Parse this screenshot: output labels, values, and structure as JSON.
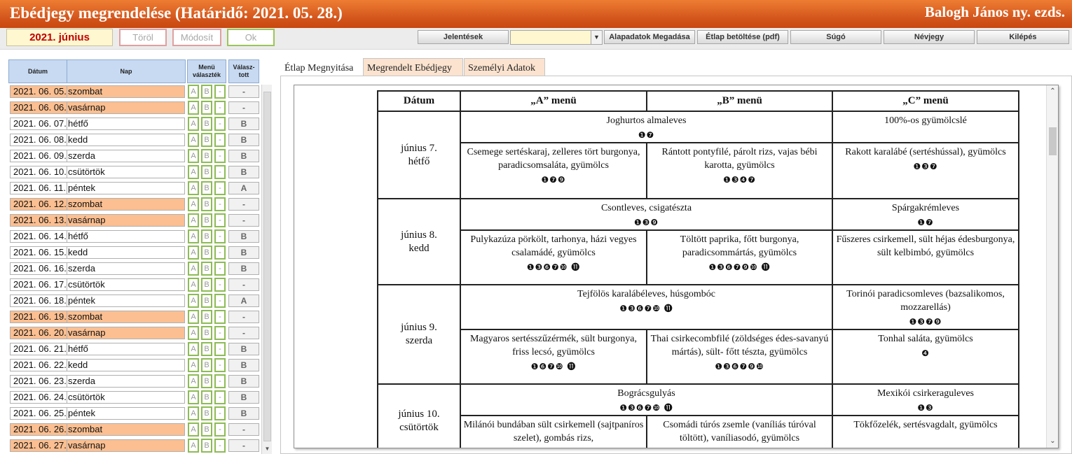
{
  "header": {
    "title": "Ebédjegy megrendelése (Határidő: 2021. 05. 28.)",
    "user": "Balogh János ny. ezds."
  },
  "toolbar": {
    "month": "2021. június",
    "delete": "Töröl",
    "modify": "Módosít",
    "ok": "Ok",
    "reports": "Jelentések",
    "combo_value": "",
    "base_data": "Alapadatok Megadása",
    "load_menu": "Étlap betöltése (pdf)",
    "help": "Súgó",
    "names": "Névjegy",
    "exit": "Kilépés"
  },
  "grid": {
    "headers": {
      "date": "Dátum",
      "day": "Nap",
      "menu": "Menü választék",
      "selected": "Válasz- tott"
    },
    "rows": [
      {
        "date": "2021. 06. 05.",
        "day": "szombat",
        "a": "A",
        "b": "B",
        "c": "-",
        "sel": "-",
        "weekend": true
      },
      {
        "date": "2021. 06. 06.",
        "day": "vasárnap",
        "a": "A",
        "b": "B",
        "c": "-",
        "sel": "-",
        "weekend": true
      },
      {
        "date": "2021. 06. 07.",
        "day": "hétfő",
        "a": "A",
        "b": "B",
        "c": "-",
        "sel": "B",
        "weekend": false
      },
      {
        "date": "2021. 06. 08.",
        "day": "kedd",
        "a": "A",
        "b": "B",
        "c": "-",
        "sel": "B",
        "weekend": false
      },
      {
        "date": "2021. 06. 09.",
        "day": "szerda",
        "a": "A",
        "b": "B",
        "c": "-",
        "sel": "B",
        "weekend": false
      },
      {
        "date": "2021. 06. 10.",
        "day": "csütörtök",
        "a": "A",
        "b": "B",
        "c": "-",
        "sel": "B",
        "weekend": false
      },
      {
        "date": "2021. 06. 11.",
        "day": "péntek",
        "a": "A",
        "b": "B",
        "c": "-",
        "sel": "A",
        "weekend": false
      },
      {
        "date": "2021. 06. 12.",
        "day": "szombat",
        "a": "A",
        "b": "B",
        "c": "-",
        "sel": "-",
        "weekend": true
      },
      {
        "date": "2021. 06. 13.",
        "day": "vasárnap",
        "a": "A",
        "b": "B",
        "c": "-",
        "sel": "-",
        "weekend": true
      },
      {
        "date": "2021. 06. 14.",
        "day": "hétfő",
        "a": "A",
        "b": "B",
        "c": "-",
        "sel": "B",
        "weekend": false
      },
      {
        "date": "2021. 06. 15.",
        "day": "kedd",
        "a": "A",
        "b": "B",
        "c": "-",
        "sel": "B",
        "weekend": false
      },
      {
        "date": "2021. 06. 16.",
        "day": "szerda",
        "a": "A",
        "b": "B",
        "c": "-",
        "sel": "B",
        "weekend": false
      },
      {
        "date": "2021. 06. 17.",
        "day": "csütörtök",
        "a": "A",
        "b": "B",
        "c": "-",
        "sel": "-",
        "weekend": false
      },
      {
        "date": "2021. 06. 18.",
        "day": "péntek",
        "a": "A",
        "b": "B",
        "c": "-",
        "sel": "A",
        "weekend": false
      },
      {
        "date": "2021. 06. 19.",
        "day": "szombat",
        "a": "A",
        "b": "B",
        "c": "-",
        "sel": "-",
        "weekend": true
      },
      {
        "date": "2021. 06. 20.",
        "day": "vasárnap",
        "a": "A",
        "b": "B",
        "c": "-",
        "sel": "-",
        "weekend": true
      },
      {
        "date": "2021. 06. 21.",
        "day": "hétfő",
        "a": "A",
        "b": "B",
        "c": "-",
        "sel": "B",
        "weekend": false
      },
      {
        "date": "2021. 06. 22.",
        "day": "kedd",
        "a": "A",
        "b": "B",
        "c": "-",
        "sel": "B",
        "weekend": false
      },
      {
        "date": "2021. 06. 23.",
        "day": "szerda",
        "a": "A",
        "b": "B",
        "c": "-",
        "sel": "B",
        "weekend": false
      },
      {
        "date": "2021. 06. 24.",
        "day": "csütörtök",
        "a": "A",
        "b": "B",
        "c": "-",
        "sel": "B",
        "weekend": false
      },
      {
        "date": "2021. 06. 25.",
        "day": "péntek",
        "a": "A",
        "b": "B",
        "c": "-",
        "sel": "B",
        "weekend": false
      },
      {
        "date": "2021. 06. 26.",
        "day": "szombat",
        "a": "A",
        "b": "B",
        "c": "-",
        "sel": "-",
        "weekend": true
      },
      {
        "date": "2021. 06. 27.",
        "day": "vasárnap",
        "a": "A",
        "b": "B",
        "c": "-",
        "sel": "-",
        "weekend": true
      }
    ]
  },
  "tabs": [
    {
      "label": "Étlap Megnyitása",
      "active": true
    },
    {
      "label": "Megrendelt Ebédjegy",
      "active": false
    },
    {
      "label": "Személyi Adatok",
      "active": false
    }
  ],
  "menu": {
    "headers": {
      "date": "Dátum",
      "a": "„A” menü",
      "b": "„B” menü",
      "c": "„C” menü"
    },
    "days": [
      {
        "day": "június 7.",
        "weekday": "hétfő",
        "soup_ab": "Joghurtos almaleves",
        "soup_ab_al": "❶❼",
        "soup_c": "100%-os gyümölcslé",
        "soup_c_al": "",
        "a": "Csemege sertéskaraj, zelleres tört burgonya, paradicsomsaláta, gyümölcs",
        "a_al": "❶❼❾",
        "b": "Rántott pontyfilé, párolt rizs, vajas bébi karotta, gyümölcs",
        "b_al": "❶❸❹❼",
        "c": "Rakott karalábé (sertéshússal), gyümölcs",
        "c_al": "❶❸❼"
      },
      {
        "day": "június 8.",
        "weekday": "kedd",
        "soup_ab": "Csontleves, csigatészta",
        "soup_ab_al": "❶❸❾",
        "soup_c": "Spárgakrémleves",
        "soup_c_al": "❶❼",
        "a": "Pulykazúza pörkölt, tarhonya, házi vegyes csalamádé, gyümölcs",
        "a_al": "❶❸❻❼❿ ⓫",
        "b": "Töltött paprika, főtt burgonya, paradicsommártás, gyümölcs",
        "b_al": "❶❸❻❼❾❿ ⓫",
        "c": "Fűszeres csirkemell, sült héjas édesburgonya, sült kelbimbó, gyümölcs",
        "c_al": ""
      },
      {
        "day": "június 9.",
        "weekday": "szerda",
        "soup_ab": "Tejfölös karalábéleves, húsgombóc",
        "soup_ab_al": "❶❸❻❼❿ ⓫",
        "soup_c": "Torinói paradicsomleves (bazsalikomos, mozzarellás)",
        "soup_c_al": "❶❸❼❾",
        "a": "Magyaros sertésszűzérmék, sült burgonya, friss lecsó, gyümölcs",
        "a_al": "❶❻❼❿ ⓫",
        "b": "Thai csirkecombfilé (zöldséges édes-savanyú mártás), sült- főtt tészta, gyümölcs",
        "b_al": "❶❸❻❼❾❿",
        "c": "Tonhal saláta, gyümölcs",
        "c_al": "❹"
      },
      {
        "day": "június 10.",
        "weekday": "csütörtök",
        "soup_ab": "Bográcsgulyás",
        "soup_ab_al": "❶❸❻❼❿ ⓫",
        "soup_c": "Mexikói csirkeraguleves",
        "soup_c_al": "❶❸",
        "a": "Milánói bundában sült csirkemell (sajtpaníros szelet), gombás rizs,",
        "a_al": "",
        "b": "Csomádi túrós zsemle (vaníliás túróval töltött), vaníliasodó, gyümölcs",
        "b_al": "",
        "c": "Tökfőzelék, sertésvagdalt, gyümölcs",
        "c_al": ""
      }
    ]
  },
  "colors": {
    "title_bar": "#d9571d",
    "weekend": "#fbbf91",
    "header_cell": "#c7daf2",
    "option_border": "#8dbb55",
    "month_text": "#c00000"
  }
}
